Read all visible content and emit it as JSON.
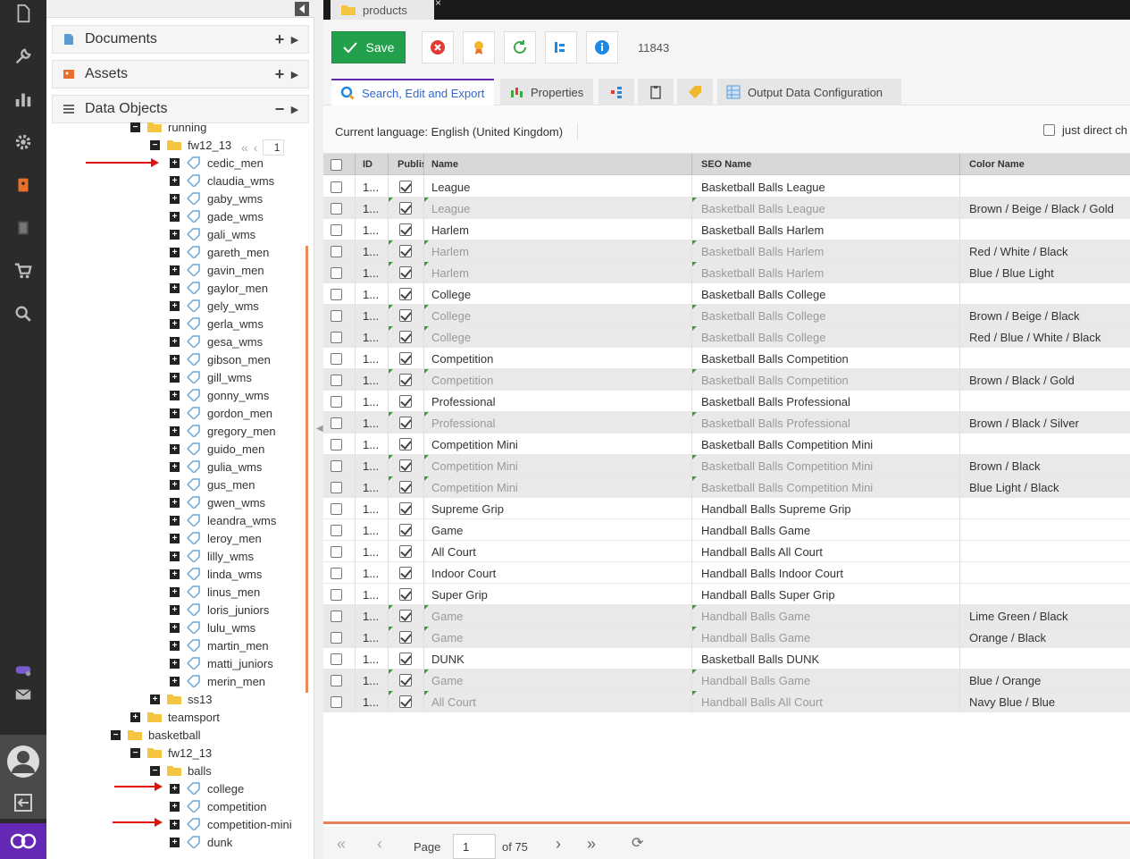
{
  "rail": {
    "icons": [
      "document-icon",
      "wrench-icon",
      "chart-icon",
      "gear-icon",
      "contacts-icon",
      "book-icon",
      "cart-icon",
      "search-icon"
    ]
  },
  "tree_panel": {
    "accordions": [
      {
        "label": "Documents",
        "action": "+",
        "icon": "document-icon"
      },
      {
        "label": "Assets",
        "action": "+",
        "icon": "image-icon"
      },
      {
        "label": "Data Objects",
        "action": "−",
        "icon": "list-icon"
      }
    ],
    "pager_page": "1",
    "nodes": [
      {
        "label": "running",
        "type": "folder",
        "box": "−",
        "level": 0
      },
      {
        "label": "fw12_13",
        "type": "folder",
        "box": "−",
        "level": 1
      },
      {
        "label": "cedic_men",
        "type": "object",
        "box": "+",
        "level": 2
      },
      {
        "label": "claudia_wms",
        "type": "object",
        "box": "+",
        "level": 2
      },
      {
        "label": "gaby_wms",
        "type": "object",
        "box": "+",
        "level": 2
      },
      {
        "label": "gade_wms",
        "type": "object",
        "box": "+",
        "level": 2
      },
      {
        "label": "gali_wms",
        "type": "object",
        "box": "+",
        "level": 2
      },
      {
        "label": "gareth_men",
        "type": "object",
        "box": "+",
        "level": 2
      },
      {
        "label": "gavin_men",
        "type": "object",
        "box": "+",
        "level": 2
      },
      {
        "label": "gaylor_men",
        "type": "object",
        "box": "+",
        "level": 2
      },
      {
        "label": "gely_wms",
        "type": "object",
        "box": "+",
        "level": 2
      },
      {
        "label": "gerla_wms",
        "type": "object",
        "box": "+",
        "level": 2
      },
      {
        "label": "gesa_wms",
        "type": "object",
        "box": "+",
        "level": 2
      },
      {
        "label": "gibson_men",
        "type": "object",
        "box": "+",
        "level": 2
      },
      {
        "label": "gill_wms",
        "type": "object",
        "box": "+",
        "level": 2
      },
      {
        "label": "gonny_wms",
        "type": "object",
        "box": "+",
        "level": 2
      },
      {
        "label": "gordon_men",
        "type": "object",
        "box": "+",
        "level": 2
      },
      {
        "label": "gregory_men",
        "type": "object",
        "box": "+",
        "level": 2
      },
      {
        "label": "guido_men",
        "type": "object",
        "box": "+",
        "level": 2
      },
      {
        "label": "gulia_wms",
        "type": "object",
        "box": "+",
        "level": 2
      },
      {
        "label": "gus_men",
        "type": "object",
        "box": "+",
        "level": 2
      },
      {
        "label": "gwen_wms",
        "type": "object",
        "box": "+",
        "level": 2
      },
      {
        "label": "leandra_wms",
        "type": "object",
        "box": "+",
        "level": 2
      },
      {
        "label": "leroy_men",
        "type": "object",
        "box": "+",
        "level": 2
      },
      {
        "label": "lilly_wms",
        "type": "object",
        "box": "+",
        "level": 2
      },
      {
        "label": "linda_wms",
        "type": "object",
        "box": "+",
        "level": 2
      },
      {
        "label": "linus_men",
        "type": "object",
        "box": "+",
        "level": 2
      },
      {
        "label": "loris_juniors",
        "type": "object",
        "box": "+",
        "level": 2
      },
      {
        "label": "lulu_wms",
        "type": "object",
        "box": "+",
        "level": 2
      },
      {
        "label": "martin_men",
        "type": "object",
        "box": "+",
        "level": 2
      },
      {
        "label": "matti_juniors",
        "type": "object",
        "box": "+",
        "level": 2
      },
      {
        "label": "merin_men",
        "type": "object",
        "box": "+",
        "level": 2
      },
      {
        "label": "ss13",
        "type": "folder",
        "box": "+",
        "level": 1
      },
      {
        "label": "teamsport",
        "type": "folder",
        "box": "+",
        "level": 0
      },
      {
        "label": "basketball",
        "type": "folder",
        "box": "−",
        "level": -1
      },
      {
        "label": "fw12_13",
        "type": "folder",
        "box": "−",
        "level": 0
      },
      {
        "label": "balls",
        "type": "folder",
        "box": "−",
        "level": 1
      },
      {
        "label": "college",
        "type": "object",
        "box": "+",
        "level": 2
      },
      {
        "label": "competition",
        "type": "object",
        "box": "+",
        "level": 2
      },
      {
        "label": "competition-mini",
        "type": "object",
        "box": "+",
        "level": 2
      },
      {
        "label": "dunk",
        "type": "object",
        "box": "+",
        "level": 2
      }
    ]
  },
  "main": {
    "doc_tab": "products",
    "toolbar": {
      "save_label": "Save",
      "object_id": "11843"
    },
    "subtabs": [
      {
        "label": "Search, Edit and Export",
        "icon": "search-icon",
        "active": true
      },
      {
        "label": "Properties",
        "icon": "properties-icon",
        "active": false
      },
      {
        "label": "",
        "icon": "tree-icon",
        "active": false
      },
      {
        "label": "",
        "icon": "clipboard-icon",
        "active": false
      },
      {
        "label": "",
        "icon": "tag-icon",
        "active": false
      },
      {
        "label": "Output Data Configuration",
        "icon": "grid-icon",
        "active": false
      }
    ],
    "language_text": "Current language: English (United Kingdom)",
    "just_direct_label": "just direct ch",
    "grid": {
      "columns": [
        "",
        "ID",
        "Publis",
        "Name",
        "SEO Name",
        "Color Name"
      ],
      "rows": [
        {
          "id": "1...",
          "name": "League",
          "seo": "Basketball Balls League",
          "color": "",
          "variant": false
        },
        {
          "id": "1...",
          "name": "League",
          "seo": "Basketball Balls League",
          "color": "Brown / Beige / Black / Gold",
          "variant": true
        },
        {
          "id": "1...",
          "name": "Harlem",
          "seo": "Basketball Balls Harlem",
          "color": "",
          "variant": false
        },
        {
          "id": "1...",
          "name": "Harlem",
          "seo": "Basketball Balls Harlem",
          "color": "Red / White / Black",
          "variant": true
        },
        {
          "id": "1...",
          "name": "Harlem",
          "seo": "Basketball Balls Harlem",
          "color": "Blue / Blue Light",
          "variant": true
        },
        {
          "id": "1...",
          "name": "College",
          "seo": "Basketball Balls College",
          "color": "",
          "variant": false
        },
        {
          "id": "1...",
          "name": "College",
          "seo": "Basketball Balls College",
          "color": "Brown / Beige / Black",
          "variant": true
        },
        {
          "id": "1...",
          "name": "College",
          "seo": "Basketball Balls College",
          "color": "Red / Blue / White / Black",
          "variant": true
        },
        {
          "id": "1...",
          "name": "Competition",
          "seo": "Basketball Balls Competition",
          "color": "",
          "variant": false
        },
        {
          "id": "1...",
          "name": "Competition",
          "seo": "Basketball Balls Competition",
          "color": "Brown / Black / Gold",
          "variant": true
        },
        {
          "id": "1...",
          "name": "Professional",
          "seo": "Basketball Balls Professional",
          "color": "",
          "variant": false
        },
        {
          "id": "1...",
          "name": "Professional",
          "seo": "Basketball Balls Professional",
          "color": "Brown / Black / Silver",
          "variant": true
        },
        {
          "id": "1...",
          "name": "Competition Mini",
          "seo": "Basketball Balls Competition Mini",
          "color": "",
          "variant": false
        },
        {
          "id": "1...",
          "name": "Competition Mini",
          "seo": "Basketball Balls Competition Mini",
          "color": "Brown / Black",
          "variant": true
        },
        {
          "id": "1...",
          "name": "Competition Mini",
          "seo": "Basketball Balls Competition Mini",
          "color": "Blue Light / Black",
          "variant": true
        },
        {
          "id": "1...",
          "name": "Supreme Grip",
          "seo": "Handball Balls Supreme Grip",
          "color": "",
          "variant": false
        },
        {
          "id": "1...",
          "name": "Game",
          "seo": "Handball Balls Game",
          "color": "",
          "variant": false
        },
        {
          "id": "1...",
          "name": "All Court",
          "seo": "Handball Balls All Court",
          "color": "",
          "variant": false
        },
        {
          "id": "1...",
          "name": "Indoor Court",
          "seo": "Handball Balls Indoor Court",
          "color": "",
          "variant": false
        },
        {
          "id": "1...",
          "name": "Super Grip",
          "seo": "Handball Balls Super Grip",
          "color": "",
          "variant": false
        },
        {
          "id": "1...",
          "name": "Game",
          "seo": "Handball Balls Game",
          "color": "Lime Green / Black",
          "variant": true
        },
        {
          "id": "1...",
          "name": "Game",
          "seo": "Handball Balls Game",
          "color": "Orange / Black",
          "variant": true
        },
        {
          "id": "1...",
          "name": "DUNK",
          "seo": "Basketball Balls DUNK",
          "color": "",
          "variant": false
        },
        {
          "id": "1...",
          "name": "Game",
          "seo": "Handball Balls Game",
          "color": "Blue / Orange",
          "variant": true
        },
        {
          "id": "1...",
          "name": "All Court",
          "seo": "Handball Balls All Court",
          "color": "Navy Blue / Blue",
          "variant": true
        }
      ]
    },
    "pager": {
      "page_label": "Page",
      "page_value": "1",
      "of_label": "of 75"
    }
  },
  "colors": {
    "accent": "#6428b4",
    "save_green": "#23a04b",
    "grid_border_accent": "#e8805a",
    "annotation_arrow": "#e01010"
  }
}
